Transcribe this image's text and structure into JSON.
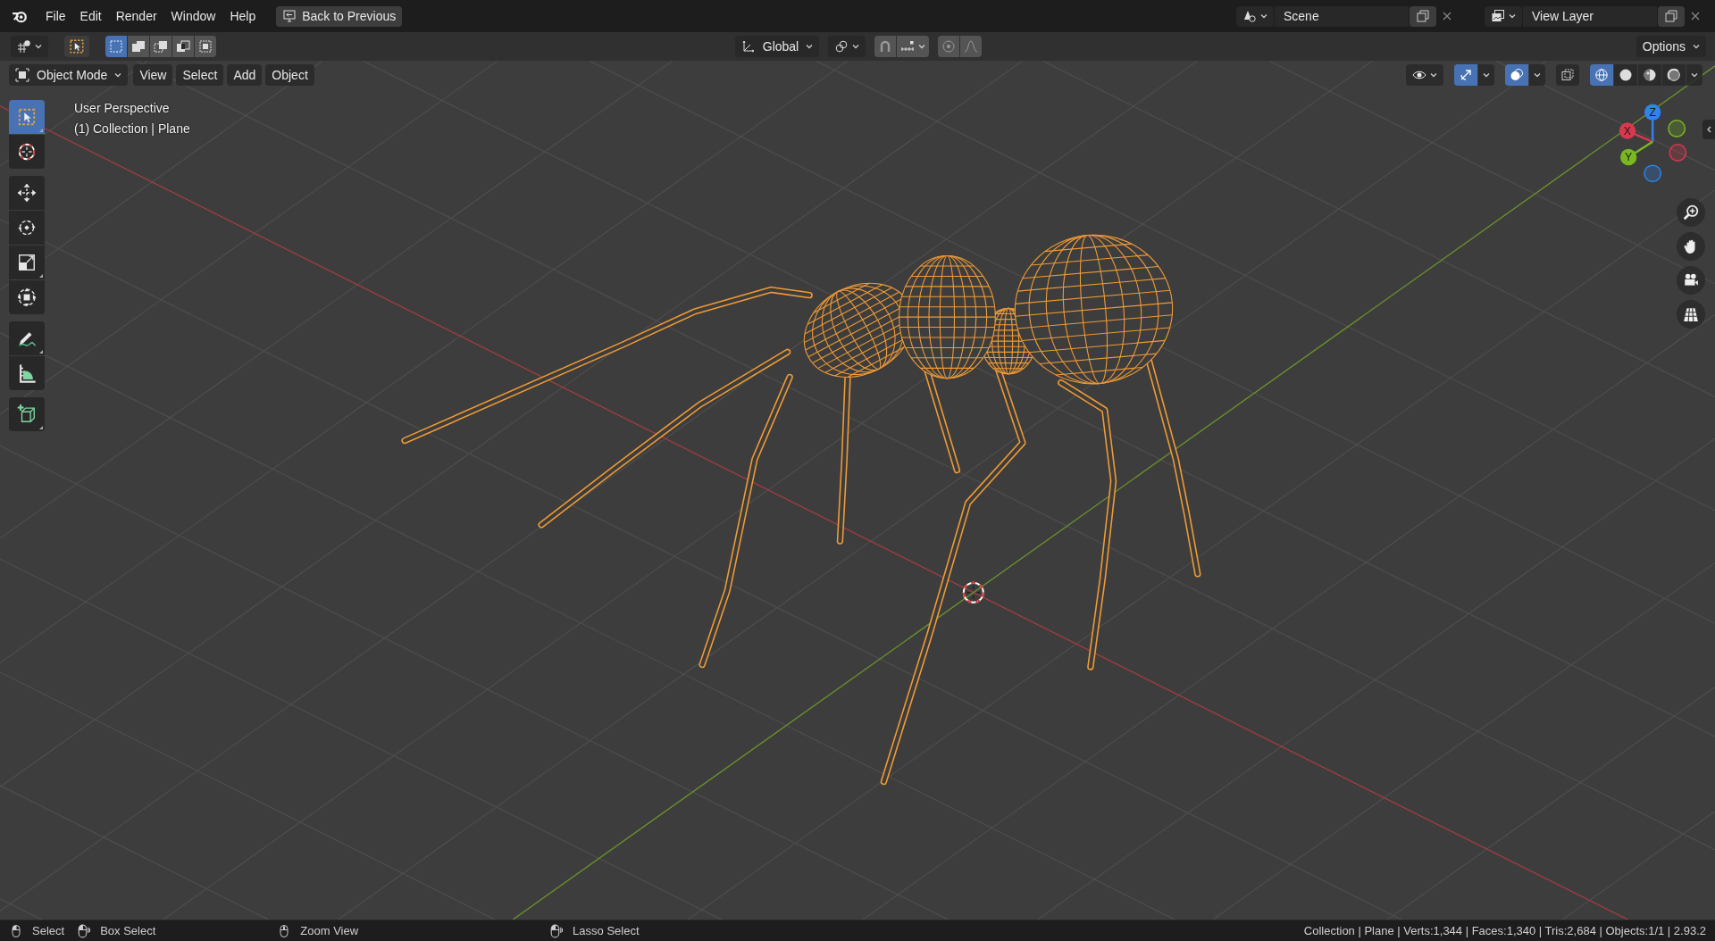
{
  "top_bar": {
    "menus": [
      "File",
      "Edit",
      "Render",
      "Window",
      "Help"
    ],
    "back_button": "Back to Previous",
    "scene": "Scene",
    "view_layer": "View Layer"
  },
  "tool_header": {
    "select_modes": [
      {
        "selected": true
      },
      {
        "selected": false
      },
      {
        "selected": false
      },
      {
        "selected": false
      },
      {
        "selected": false
      }
    ],
    "orientation": "Global",
    "snap": {
      "on": false
    },
    "proportional_edit": {
      "on": false
    },
    "options": "Options"
  },
  "viewport_header": {
    "mode": "Object Mode",
    "menus": [
      "View",
      "Select",
      "Add",
      "Object"
    ],
    "gizmos": {
      "on": true
    },
    "overlays": {
      "on": true
    },
    "xray": {
      "on": false
    },
    "shading": [
      {
        "selected": true
      },
      {
        "selected": false
      },
      {
        "selected": false
      },
      {
        "selected": false
      }
    ]
  },
  "viewport": {
    "perspective": "User Perspective",
    "active_object": "(1) Collection | Plane"
  },
  "toolbar": [
    {
      "selected": true
    },
    {
      "selected": false
    },
    {
      "selected": false
    },
    {
      "selected": false
    },
    {
      "selected": false
    },
    {
      "selected": false
    },
    {
      "selected": false
    },
    {
      "selected": false
    },
    {
      "selected": false
    }
  ],
  "gizmo": {
    "axes": [
      {
        "label": "Z",
        "color": "#2f83ea"
      },
      {
        "label": "X",
        "color": "#d7394e"
      },
      {
        "label": "Y",
        "color": "#79b91f"
      }
    ]
  },
  "status_bar": {
    "hints": [
      {
        "label": "Select"
      },
      {
        "label": "Box Select"
      },
      {
        "label": "Zoom View"
      },
      {
        "label": "Lasso Select"
      }
    ],
    "stats": "Collection | Plane | Verts:1,344 | Faces:1,340 | Tris:2,684 | Objects:1/1 | 2.93.2"
  }
}
